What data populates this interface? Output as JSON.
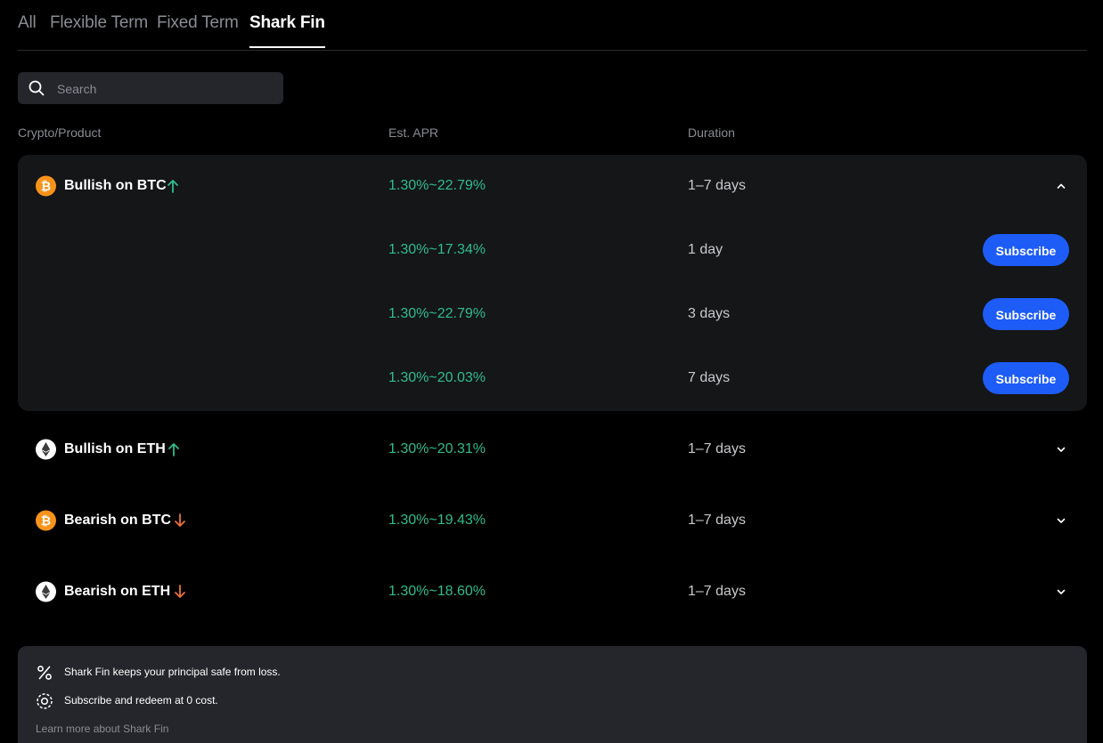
{
  "tabs": [
    "All",
    "Flexible Term",
    "Fixed Term",
    "Shark Fin"
  ],
  "active_tab": "Shark Fin",
  "search": {
    "placeholder": "Search",
    "value": ""
  },
  "table": {
    "headers": [
      "Crypto/Product",
      "Est. APR",
      "Duration"
    ]
  },
  "products": [
    {
      "name": "Bullish on BTC",
      "coin": "btc",
      "trend": "up",
      "apr": "1.30%~22.79%",
      "duration": "1–7 days",
      "expanded": true,
      "options": [
        {
          "apr": "1.30%~17.34%",
          "duration": "1 day",
          "button": "Subscribe"
        },
        {
          "apr": "1.30%~22.79%",
          "duration": "3 days",
          "button": "Subscribe"
        },
        {
          "apr": "1.30%~20.03%",
          "duration": "7 days",
          "button": "Subscribe"
        }
      ]
    },
    {
      "name": "Bullish on ETH",
      "coin": "eth",
      "trend": "up",
      "apr": "1.30%~20.31%",
      "duration": "1–7 days",
      "expanded": false
    },
    {
      "name": "Bearish on BTC",
      "coin": "btc",
      "trend": "down",
      "apr": "1.30%~19.43%",
      "duration": "1–7 days",
      "expanded": false
    },
    {
      "name": "Bearish on ETH",
      "coin": "eth",
      "trend": "down",
      "apr": "1.30%~18.60%",
      "duration": "1–7 days",
      "expanded": false
    }
  ],
  "info": {
    "lines": [
      {
        "icon": "percent-icon",
        "text": "Shark Fin keeps your principal safe from loss."
      },
      {
        "icon": "zero-cost-icon",
        "text": "Subscribe and redeem at 0 cost."
      }
    ],
    "link": "Learn more about Shark Fin"
  },
  "colors": {
    "background": "#000000",
    "card": "#141617",
    "accent_green": "#2fbc8e",
    "button_blue": "#1d5cf7",
    "trend_up": "#2fbc8e",
    "trend_down": "#f0703a",
    "btc": "#f7931a"
  }
}
